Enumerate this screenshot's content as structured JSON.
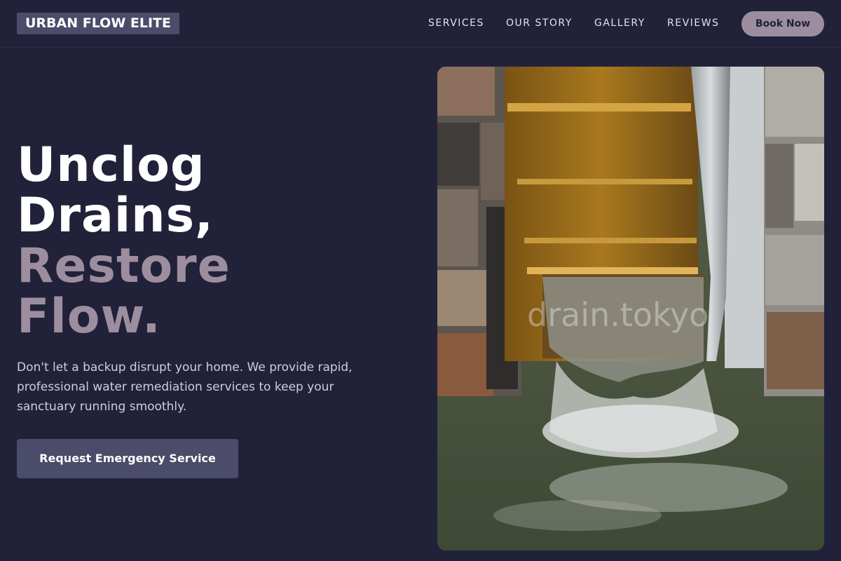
{
  "header": {
    "logo_text": "URBAN FLOW ELITE",
    "nav": [
      {
        "label": "SERVICES"
      },
      {
        "label": "OUR STORY"
      },
      {
        "label": "GALLERY"
      },
      {
        "label": "REVIEWS"
      }
    ],
    "book_label": "Book Now"
  },
  "hero": {
    "headline_line1": "Unclog",
    "headline_line2": "Drains,",
    "headline_line3": "Restore",
    "headline_line4": "Flow.",
    "description": "Don't let a backup disrupt your home. We provide rapid, professional water remediation services to keep your sanctuary running smoothly.",
    "cta_label": "Request Emergency Service",
    "image_watermark": "drain.tokyo"
  },
  "colors": {
    "background": "#22213a",
    "accent_muted": "#9c8e9e",
    "button": "#4a4c69"
  }
}
